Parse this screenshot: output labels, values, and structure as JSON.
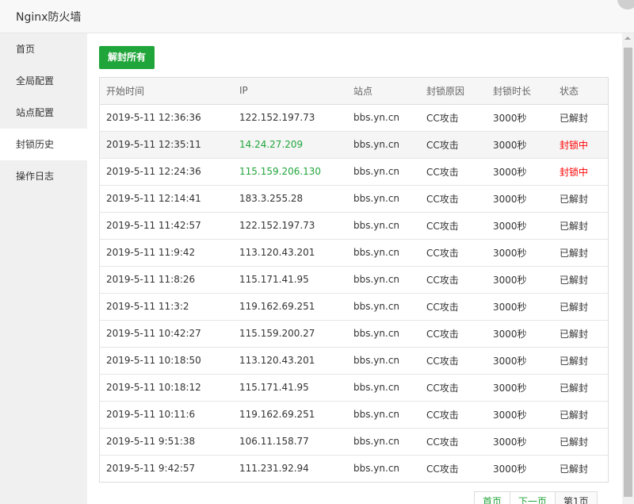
{
  "window": {
    "title": "Nginx防火墙"
  },
  "sidebar": {
    "items": [
      {
        "label": "首页"
      },
      {
        "label": "全局配置"
      },
      {
        "label": "站点配置"
      },
      {
        "label": "封锁历史"
      },
      {
        "label": "操作日志"
      }
    ],
    "active_index": 3
  },
  "toolbar": {
    "unblock_all_label": "解封所有"
  },
  "table": {
    "headers": [
      "开始时间",
      "IP",
      "站点",
      "封锁原因",
      "封锁时长",
      "状态"
    ],
    "rows": [
      [
        "2019-5-11 12:36:36",
        "122.152.197.73",
        "bbs.yn.cn",
        "CC攻击",
        "3000秒",
        "已解封"
      ],
      [
        "2019-5-11 12:35:11",
        "14.24.27.209",
        "bbs.yn.cn",
        "CC攻击",
        "3000秒",
        "封锁中"
      ],
      [
        "2019-5-11 12:24:36",
        "115.159.206.130",
        "bbs.yn.cn",
        "CC攻击",
        "3000秒",
        "封锁中"
      ],
      [
        "2019-5-11 12:14:41",
        "183.3.255.28",
        "bbs.yn.cn",
        "CC攻击",
        "3000秒",
        "已解封"
      ],
      [
        "2019-5-11 11:42:57",
        "122.152.197.73",
        "bbs.yn.cn",
        "CC攻击",
        "3000秒",
        "已解封"
      ],
      [
        "2019-5-11 11:9:42",
        "113.120.43.201",
        "bbs.yn.cn",
        "CC攻击",
        "3000秒",
        "已解封"
      ],
      [
        "2019-5-11 11:8:26",
        "115.171.41.95",
        "bbs.yn.cn",
        "CC攻击",
        "3000秒",
        "已解封"
      ],
      [
        "2019-5-11 11:3:2",
        "119.162.69.251",
        "bbs.yn.cn",
        "CC攻击",
        "3000秒",
        "已解封"
      ],
      [
        "2019-5-11 10:42:27",
        "115.159.200.27",
        "bbs.yn.cn",
        "CC攻击",
        "3000秒",
        "已解封"
      ],
      [
        "2019-5-11 10:18:50",
        "113.120.43.201",
        "bbs.yn.cn",
        "CC攻击",
        "3000秒",
        "已解封"
      ],
      [
        "2019-5-11 10:18:12",
        "115.171.41.95",
        "bbs.yn.cn",
        "CC攻击",
        "3000秒",
        "已解封"
      ],
      [
        "2019-5-11 10:11:6",
        "119.162.69.251",
        "bbs.yn.cn",
        "CC攻击",
        "3000秒",
        "已解封"
      ],
      [
        "2019-5-11 9:51:38",
        "106.11.158.77",
        "bbs.yn.cn",
        "CC攻击",
        "3000秒",
        "已解封"
      ],
      [
        "2019-5-11 9:42:57",
        "111.231.92.94",
        "bbs.yn.cn",
        "CC攻击",
        "3000秒",
        "已解封"
      ]
    ],
    "highlighted_row": 1,
    "active_status": "封锁中"
  },
  "pagination": {
    "first": "首页",
    "next": "下一页",
    "current": "第1页"
  },
  "colors": {
    "accent": "#20a53a",
    "blocked": "#ff0000"
  }
}
